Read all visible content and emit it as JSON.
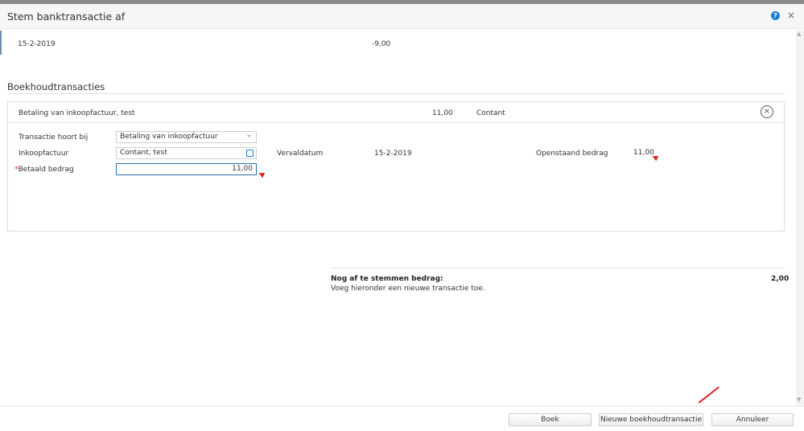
{
  "dialog": {
    "title": "Stem banktransactie af"
  },
  "bank_transaction": {
    "date": "15-2-2019",
    "amount": "-9,00"
  },
  "section_title": "Boekhoudtransacties",
  "transaction": {
    "summary": "Betaling van inkoopfactuur, test",
    "amount": "11,00",
    "method": "Contant",
    "belongs_to_label": "Transactie hoort bij",
    "belongs_to_value": "Betaling van inkoopfactuur",
    "invoice_label": "Inkoopfactuur",
    "invoice_value": "Contant, test",
    "due_date_label": "Vervaldatum",
    "due_date_value": "15-2-2019",
    "outstanding_label": "Openstaand bedrag",
    "outstanding_value": "11,00",
    "paid_label": "Betaald bedrag",
    "paid_value": "11,00",
    "required_mark": "*"
  },
  "summary": {
    "label": "Nog af te stemmen bedrag:",
    "value": "2,00",
    "hint": "Voeg hieronder een nieuwe transactie toe."
  },
  "footer": {
    "book": "Boek",
    "new_transaction": "Nieuwe boekhoudtransactie",
    "cancel": "Annuleer"
  },
  "icons": {
    "help": "?",
    "close": "×",
    "remove": "×",
    "chevron": "⌄"
  },
  "colors": {
    "accent": "#1a7fd4",
    "annotation": "#e02020"
  }
}
